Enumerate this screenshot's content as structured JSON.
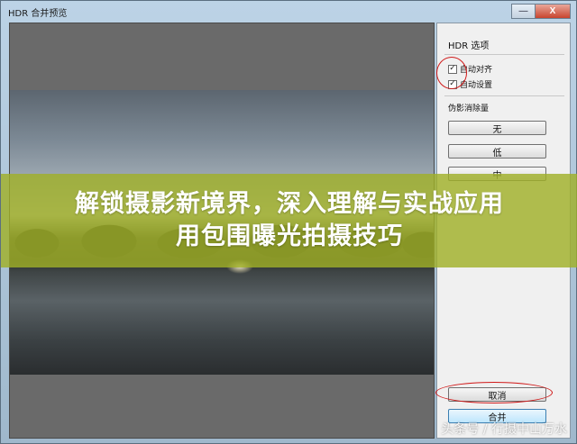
{
  "window": {
    "title": "HDR 合并预览",
    "minimize_label": "—",
    "close_label": "X"
  },
  "panel": {
    "title": "HDR 选项",
    "auto_align_label": "自动对齐",
    "auto_align_checked": true,
    "auto_settings_label": "自动设置",
    "auto_settings_checked": true,
    "deghost_label": "伪影消除量",
    "deghost_options": [
      "无",
      "低",
      "中"
    ],
    "cancel_label": "取消",
    "merge_label": "合并"
  },
  "banner": {
    "line1": "解锁摄影新境界，深入理解与实战应用",
    "line2": "用包围曝光拍摄技巧"
  },
  "watermark": "头条号 / 行摄中山万水",
  "colors": {
    "banner_bg": "#a0b028",
    "annotation_red": "#d01818",
    "primary_button": "#bee6fd"
  }
}
